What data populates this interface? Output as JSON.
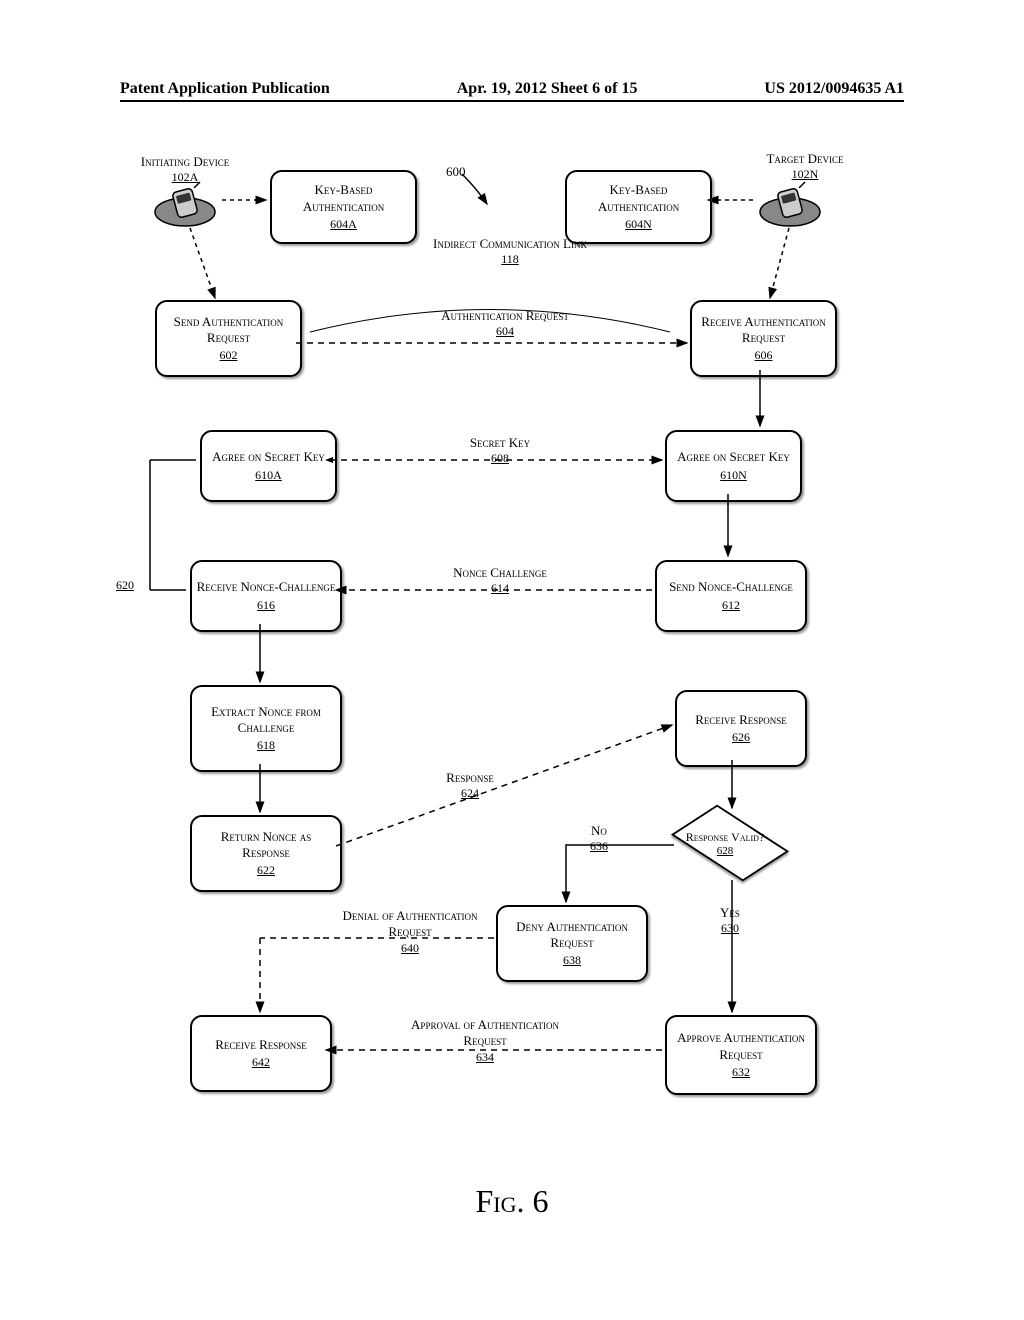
{
  "header": {
    "left": "Patent Application Publication",
    "center": "Apr. 19, 2012  Sheet 6 of 15",
    "right": "US 2012/0094635 A1"
  },
  "figure_caption": "Fig. 6",
  "diagram_ref": "600",
  "devices": {
    "initiating": {
      "label": "Initiating Device",
      "ref": "102A"
    },
    "target": {
      "label": "Target Device",
      "ref": "102N"
    }
  },
  "labels": {
    "indirect_link": {
      "text": "Indirect Communication Link",
      "ref": "118"
    },
    "auth_request": {
      "text": "Authentication Request",
      "ref": "604"
    },
    "secret_key": {
      "text": "Secret Key",
      "ref": "608"
    },
    "nonce_challenge": {
      "text": "Nonce Challenge",
      "ref": "614"
    },
    "response": {
      "text": "Response",
      "ref": "624"
    },
    "approval": {
      "text": "Approval of Authentication Request",
      "ref": "634"
    },
    "denial": {
      "text": "Denial of Authentication Request",
      "ref": "640"
    },
    "side_ref": "620",
    "no": {
      "text": "No",
      "ref": "636"
    },
    "yes": {
      "text": "Yes",
      "ref": "630"
    }
  },
  "nodes": {
    "key_auth_a": {
      "text": "Key-Based Authentication",
      "ref": "604A"
    },
    "key_auth_n": {
      "text": "Key-Based Authentication",
      "ref": "604N"
    },
    "send_auth": {
      "text": "Send Authentication Request",
      "ref": "602"
    },
    "recv_auth": {
      "text": "Receive Authentication Request",
      "ref": "606"
    },
    "agree_a": {
      "text": "Agree on Secret Key",
      "ref": "610A"
    },
    "agree_n": {
      "text": "Agree on Secret Key",
      "ref": "610N"
    },
    "recv_nonce": {
      "text": "Receive Nonce-Challenge",
      "ref": "616"
    },
    "send_nonce": {
      "text": "Send Nonce-Challenge",
      "ref": "612"
    },
    "extract_nonce": {
      "text": "Extract Nonce from Challenge",
      "ref": "618"
    },
    "recv_response": {
      "text": "Receive Response",
      "ref": "626"
    },
    "return_nonce": {
      "text": "Return Nonce as Response",
      "ref": "622"
    },
    "response_valid": {
      "text": "Response Valid?",
      "ref": "628"
    },
    "deny": {
      "text": "Deny Authentication Request",
      "ref": "638"
    },
    "approve": {
      "text": "Approve Authentication Request",
      "ref": "632"
    },
    "recv_resp2": {
      "text": "Receive Response",
      "ref": "642"
    }
  }
}
